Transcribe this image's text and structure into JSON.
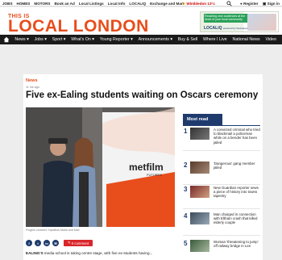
{
  "topbar": {
    "links": [
      "JOBS",
      "HOMES",
      "MOTORS",
      "Book an Ad",
      "Local Listings",
      "Local Info",
      "LOCALIQ",
      "Exchange and Mart"
    ],
    "weather_city": "Wimbledon",
    "weather_temp": "13°c",
    "register_label": "Register",
    "signin_label": "Sign in"
  },
  "masthead": {
    "logo_top": "THIS IS",
    "logo_main": "LOCAL LONDON",
    "ad_text": "Reaching new audiences at the heart of your local community",
    "ad_brand": "LOCALiQ",
    "ad_brand_sub": "powered by Newsquest"
  },
  "nav": {
    "items": [
      "News ▾",
      "Jobs ▾",
      "Sport ▾",
      "What's On ▾",
      "Young Reporter ▾",
      "Announcements ▾",
      "Buy & Sell",
      "Where I Live",
      "National News",
      "Video"
    ]
  },
  "article": {
    "category": "News",
    "date": "11 hrs ago",
    "title": "Five ex-Ealing students waiting on Oscars ceremony",
    "caption": "Fingers crossed: Yopaflow Marla and Max",
    "hero_brand": "metfilm",
    "hero_brand_sub": "FUTURES",
    "body_lead": "EALING'S",
    "body_rest": " media school is taking centre stage, with five ex-students having..."
  },
  "share": {
    "icons": [
      "f",
      "t",
      "in",
      "✉"
    ],
    "comment_label": "0 comment"
  },
  "most_read": {
    "heading": "Most read",
    "items": [
      {
        "num": "1",
        "text": "A convicted criminal who tried to blackmail a policeman while on a bender has been jailed"
      },
      {
        "num": "2",
        "text": "'Dangerous' gang member jailed"
      },
      {
        "num": "3",
        "text": "New Guardian reporter sews a piece of history into towns tapestry"
      },
      {
        "num": "4",
        "text": "Man charged in connection with Eltham crash that killed elderly couple"
      },
      {
        "num": "5",
        "text": "Woman 'threatening to jump' off railway bridge in Lee"
      }
    ]
  },
  "colors": {
    "brand_orange": "#e84d1c",
    "navy": "#1f3b6e",
    "nav_bg": "#1b1b1b",
    "comment_red": "#d9262b"
  }
}
